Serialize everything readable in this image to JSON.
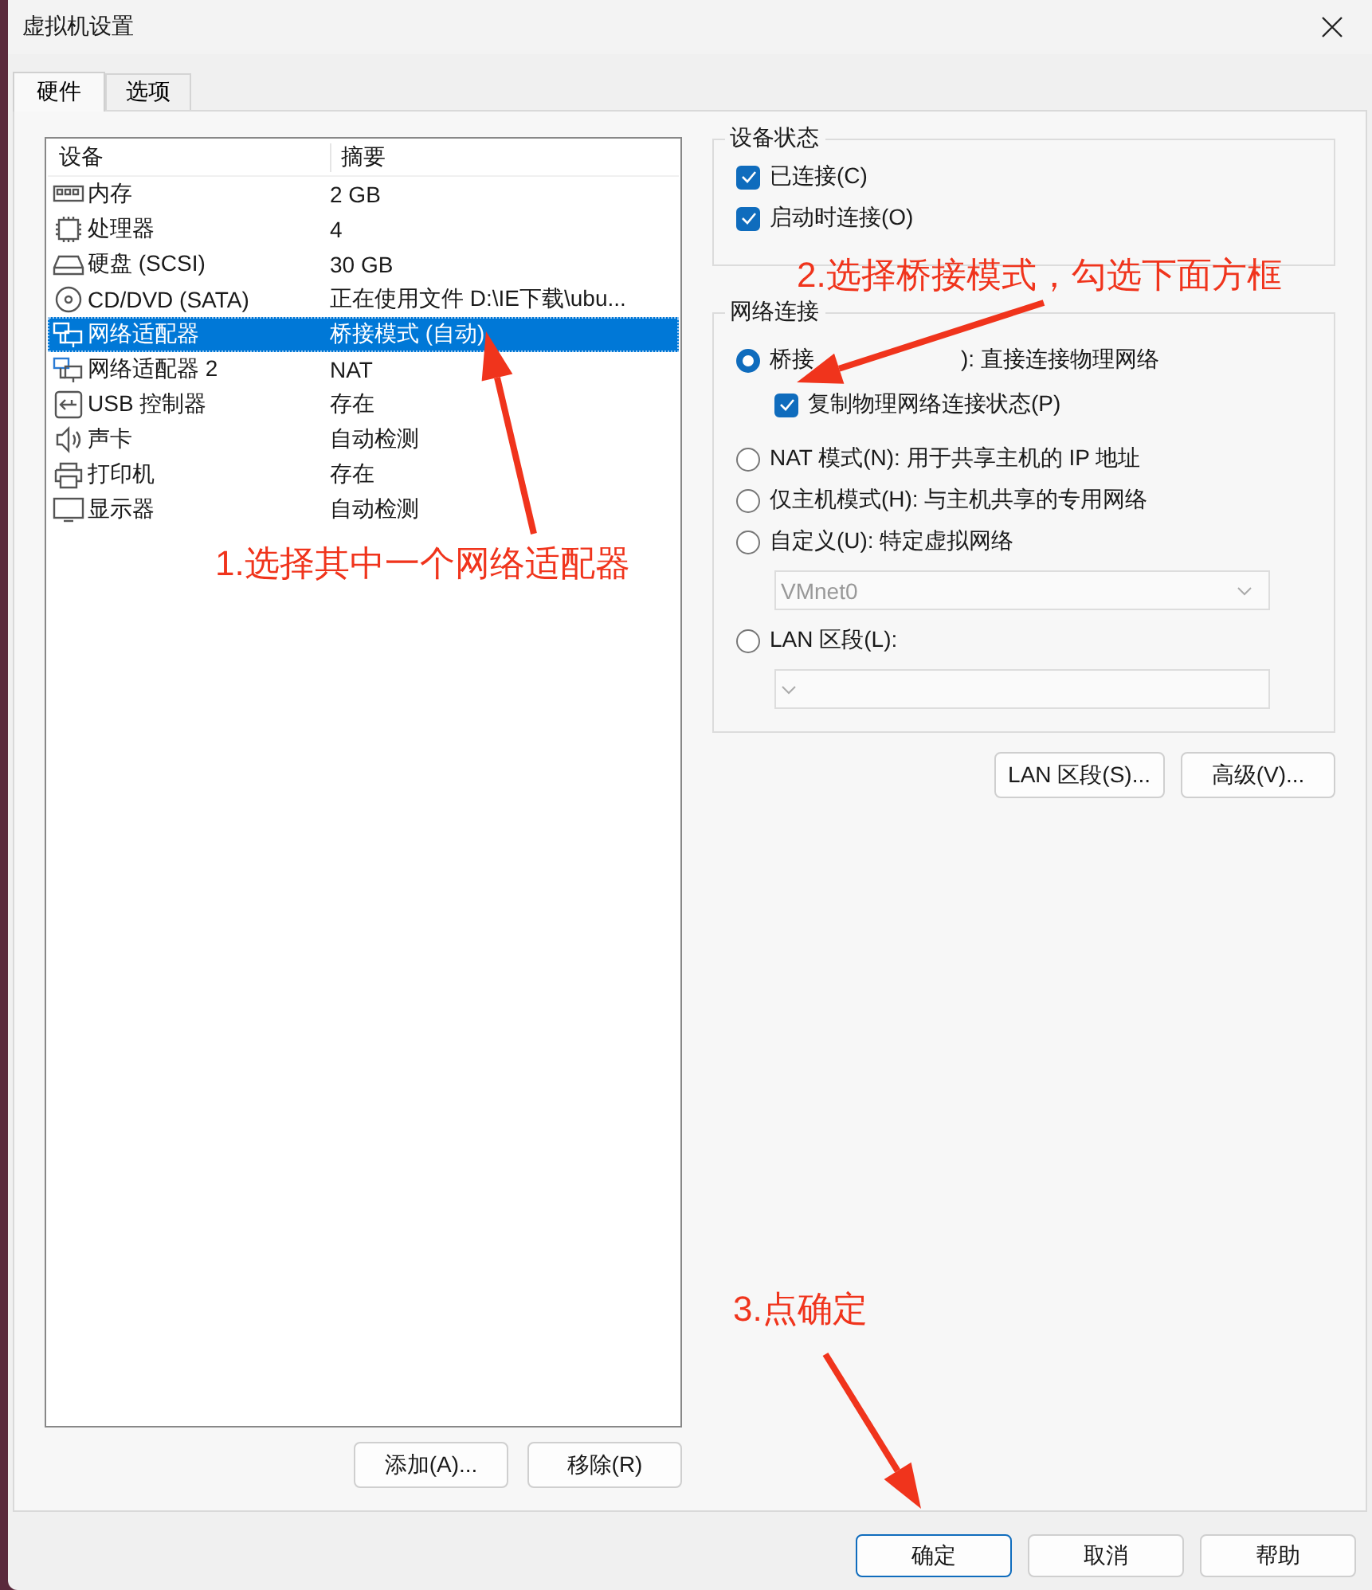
{
  "window": {
    "title": "虚拟机设置"
  },
  "tabs": [
    {
      "label": "硬件",
      "selected": true
    },
    {
      "label": "选项",
      "selected": false
    }
  ],
  "device_list": {
    "columns": [
      "设备",
      "摘要"
    ],
    "rows": [
      {
        "kind": "memory",
        "device": "内存",
        "summary": "2 GB",
        "selected": false
      },
      {
        "kind": "cpu",
        "device": "处理器",
        "summary": "4",
        "selected": false
      },
      {
        "kind": "disk",
        "device": "硬盘 (SCSI)",
        "summary": "30 GB",
        "selected": false
      },
      {
        "kind": "cd",
        "device": "CD/DVD (SATA)",
        "summary": "正在使用文件 D:\\IE下载\\ubu...",
        "selected": false
      },
      {
        "kind": "network",
        "device": "网络适配器",
        "summary": "桥接模式 (自动)",
        "selected": true
      },
      {
        "kind": "network",
        "device": "网络适配器 2",
        "summary": "NAT",
        "selected": false
      },
      {
        "kind": "usb",
        "device": "USB 控制器",
        "summary": "存在",
        "selected": false
      },
      {
        "kind": "sound",
        "device": "声卡",
        "summary": "自动检测",
        "selected": false
      },
      {
        "kind": "printer",
        "device": "打印机",
        "summary": "存在",
        "selected": false
      },
      {
        "kind": "display",
        "device": "显示器",
        "summary": "自动检测",
        "selected": false
      }
    ]
  },
  "list_buttons": [
    "添加(A)...",
    "移除(R)"
  ],
  "device_status": {
    "title": "设备状态",
    "checkboxes": [
      {
        "label": "已连接(C)",
        "checked": true
      },
      {
        "label": "启动时连接(O)",
        "checked": true
      }
    ]
  },
  "network_connection": {
    "title": "网络连接",
    "options": [
      {
        "label": "桥接",
        "label_after_arrow": "): 直接连接物理网络",
        "selected": true,
        "sub_checkbox": {
          "label": "复制物理网络连接状态(P)",
          "checked": true
        }
      },
      {
        "label": "NAT 模式(N): 用于共享主机的 IP 地址",
        "selected": false
      },
      {
        "label": "仅主机模式(H): 与主机共享的专用网络",
        "selected": false
      },
      {
        "label": "自定义(U): 特定虚拟网络",
        "selected": false,
        "dropdown": {
          "value": "VMnet0",
          "disabled": true
        }
      },
      {
        "label": "LAN 区段(L):",
        "selected": false,
        "dropdown": {
          "disabled": true
        }
      }
    ]
  },
  "right_buttons": [
    "LAN 区段(S)...",
    "高级(V)..."
  ],
  "dialog_buttons": [
    {
      "label": "确定",
      "default": true
    },
    {
      "label": "取消",
      "default": false
    },
    {
      "label": "帮助",
      "default": false
    }
  ],
  "annotations": [
    {
      "text": "1.选择其中一个网络适配器"
    },
    {
      "text": "2.选择桥接模式，勾选下面方框"
    },
    {
      "text": "3.点确定"
    }
  ]
}
